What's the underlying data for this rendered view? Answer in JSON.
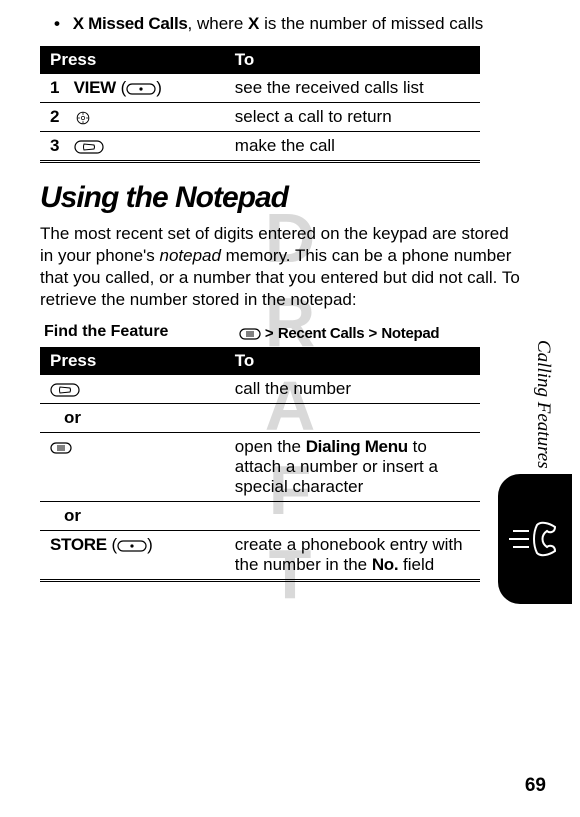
{
  "watermark": "DRAFT",
  "bullet": {
    "lead": "X Missed Calls",
    "rest": ", where ",
    "x": "X",
    "tail": " is the number of missed calls"
  },
  "table1": {
    "h1": "Press",
    "h2": "To",
    "rows": [
      {
        "n": "1",
        "key": "VIEW",
        "key_suffix": " (",
        "key_close": ")",
        "desc": "see the received calls list"
      },
      {
        "n": "2",
        "key_symbol": "nav",
        "desc": "select a call to return"
      },
      {
        "n": "3",
        "key_symbol": "send",
        "desc": "make the call"
      }
    ]
  },
  "section": "Using the Notepad",
  "para": "The most recent set of digits entered on the keypad are stored in your phone's ",
  "para_em": "notepad",
  "para_tail": " memory. This can be a phone number that you called, or a number that you entered but did not call. To retrieve the number stored in the notepad:",
  "find": "Find the Feature",
  "path_a": "Recent Calls",
  "path_b": "Notepad",
  "table2": {
    "h1": "Press",
    "h2": "To",
    "r1_desc": "call the number",
    "or": "or",
    "r2_desc1": "open the ",
    "r2_bold": "Dialing Menu",
    "r2_desc2": " to attach a number or insert a special character",
    "r3_key": "STORE",
    "r3_key_paren_open": " (",
    "r3_key_paren_close": ")",
    "r3_desc1": "create a phonebook entry with the number in the ",
    "r3_bold": "No.",
    "r3_desc2": " field"
  },
  "side": "Calling Features",
  "pagenum": "69"
}
